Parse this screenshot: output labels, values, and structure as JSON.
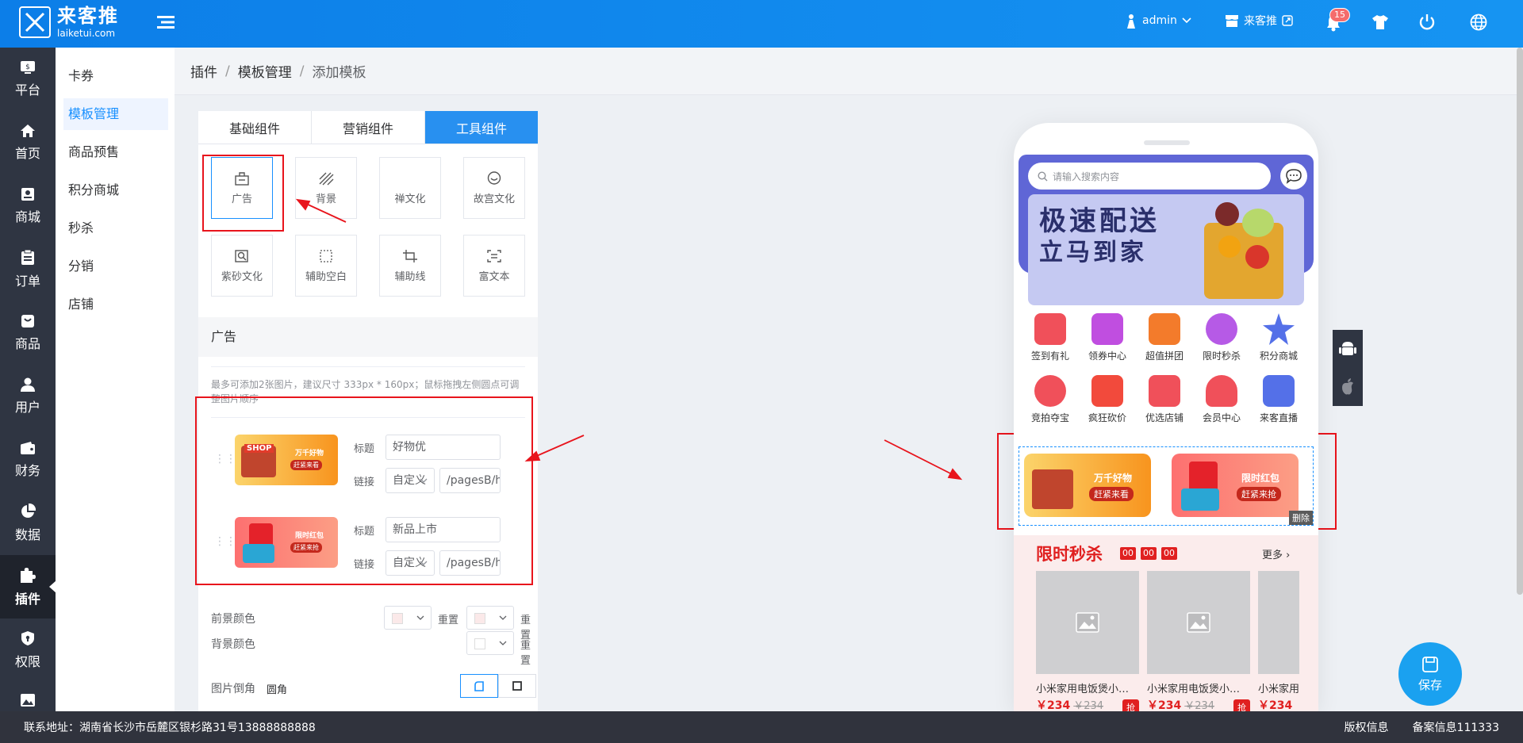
{
  "header": {
    "logo_name": "来客推",
    "logo_sub": "laiketui.com",
    "user": "admin",
    "store": "来客推",
    "notifications": "15"
  },
  "leftnav": [
    "平台",
    "首页",
    "商城",
    "订单",
    "商品",
    "用户",
    "财务",
    "数据",
    "插件",
    "权限"
  ],
  "subnav": [
    "卡券",
    "模板管理",
    "商品预售",
    "积分商城",
    "秒杀",
    "分销",
    "店铺"
  ],
  "breadcrumb": [
    "插件",
    "模板管理",
    "添加模板"
  ],
  "panel": {
    "tabs": [
      "基础组件",
      "营销组件",
      "工具组件"
    ],
    "components": [
      "广告",
      "背景",
      "禅文化",
      "故宫文化",
      "紫砂文化",
      "辅助空白",
      "辅助线",
      "富文本"
    ],
    "section_title": "广告",
    "tip": "最多可添加2张图片，建议尺寸 333px * 160px；鼠标拖拽左侧圆点可调整图片顺序",
    "ads": [
      {
        "title_label": "标题",
        "title_value": "好物优",
        "link_label": "链接",
        "link_type": "自定义",
        "link_value": "/pagesB/home",
        "img_line1": "万千好物",
        "img_line2": "赶紧来看",
        "img_tag": "SHOP"
      },
      {
        "title_label": "标题",
        "title_value": "新品上市",
        "link_label": "链接",
        "link_type": "自定义",
        "link_value": "/pagesB/home",
        "img_line1": "限时红包",
        "img_line2": "赶紧来抢",
        "img_tag": ""
      }
    ],
    "fg_label": "前景颜色",
    "bg_label": "背景颜色",
    "reset": "重置",
    "corner_label": "图片倒角",
    "corner_value": "圆角",
    "fg_color": "#fbe9e9",
    "bg_color": "#ffffff"
  },
  "preview": {
    "search_placeholder": "请输入搜索内容",
    "banner_text1": "极速配送",
    "banner_text2": "立马到家",
    "icons": [
      {
        "label": "签到有礼",
        "color": "#f0505a"
      },
      {
        "label": "领券中心",
        "color": "#c04ee0"
      },
      {
        "label": "超值拼团",
        "color": "#f37b2b"
      },
      {
        "label": "限时秒杀",
        "color": "#b65ae6"
      },
      {
        "label": "积分商城",
        "color": "#5470e8"
      },
      {
        "label": "竞拍夺宝",
        "color": "#f0505a"
      },
      {
        "label": "疯狂砍价",
        "color": "#f24a3c"
      },
      {
        "label": "优选店铺",
        "color": "#f0505a"
      },
      {
        "label": "会员中心",
        "color": "#f0505a"
      },
      {
        "label": "来客直播",
        "color": "#5470e8"
      }
    ],
    "ad1_line1": "万千好物",
    "ad1_line2": "赶紧来看",
    "ad2_line1": "限时红包",
    "ad2_line2": "赶紧来抢",
    "delete": "删除",
    "flash_title": "限时秒杀",
    "countdown": [
      "00",
      "00",
      "00"
    ],
    "more": "更多",
    "products": [
      {
        "name": "小米家用电饭煲小米电饭煲",
        "price": "￥234",
        "old": "￥234",
        "buy": "抢"
      },
      {
        "name": "小米家用电饭煲小米电饭煲",
        "price": "￥234",
        "old": "￥234",
        "buy": "抢"
      },
      {
        "name": "小米家用",
        "price": "￥234",
        "old": "",
        "buy": ""
      }
    ]
  },
  "save": "保存",
  "footer": {
    "address": "联系地址：湖南省长沙市岳麓区银杉路31号13888888888",
    "copyright": "版权信息",
    "record": "备案信息111333"
  },
  "colors": {
    "accent": "#1890ff",
    "annotation": "#e8141c",
    "sidebar": "#2f3542"
  }
}
